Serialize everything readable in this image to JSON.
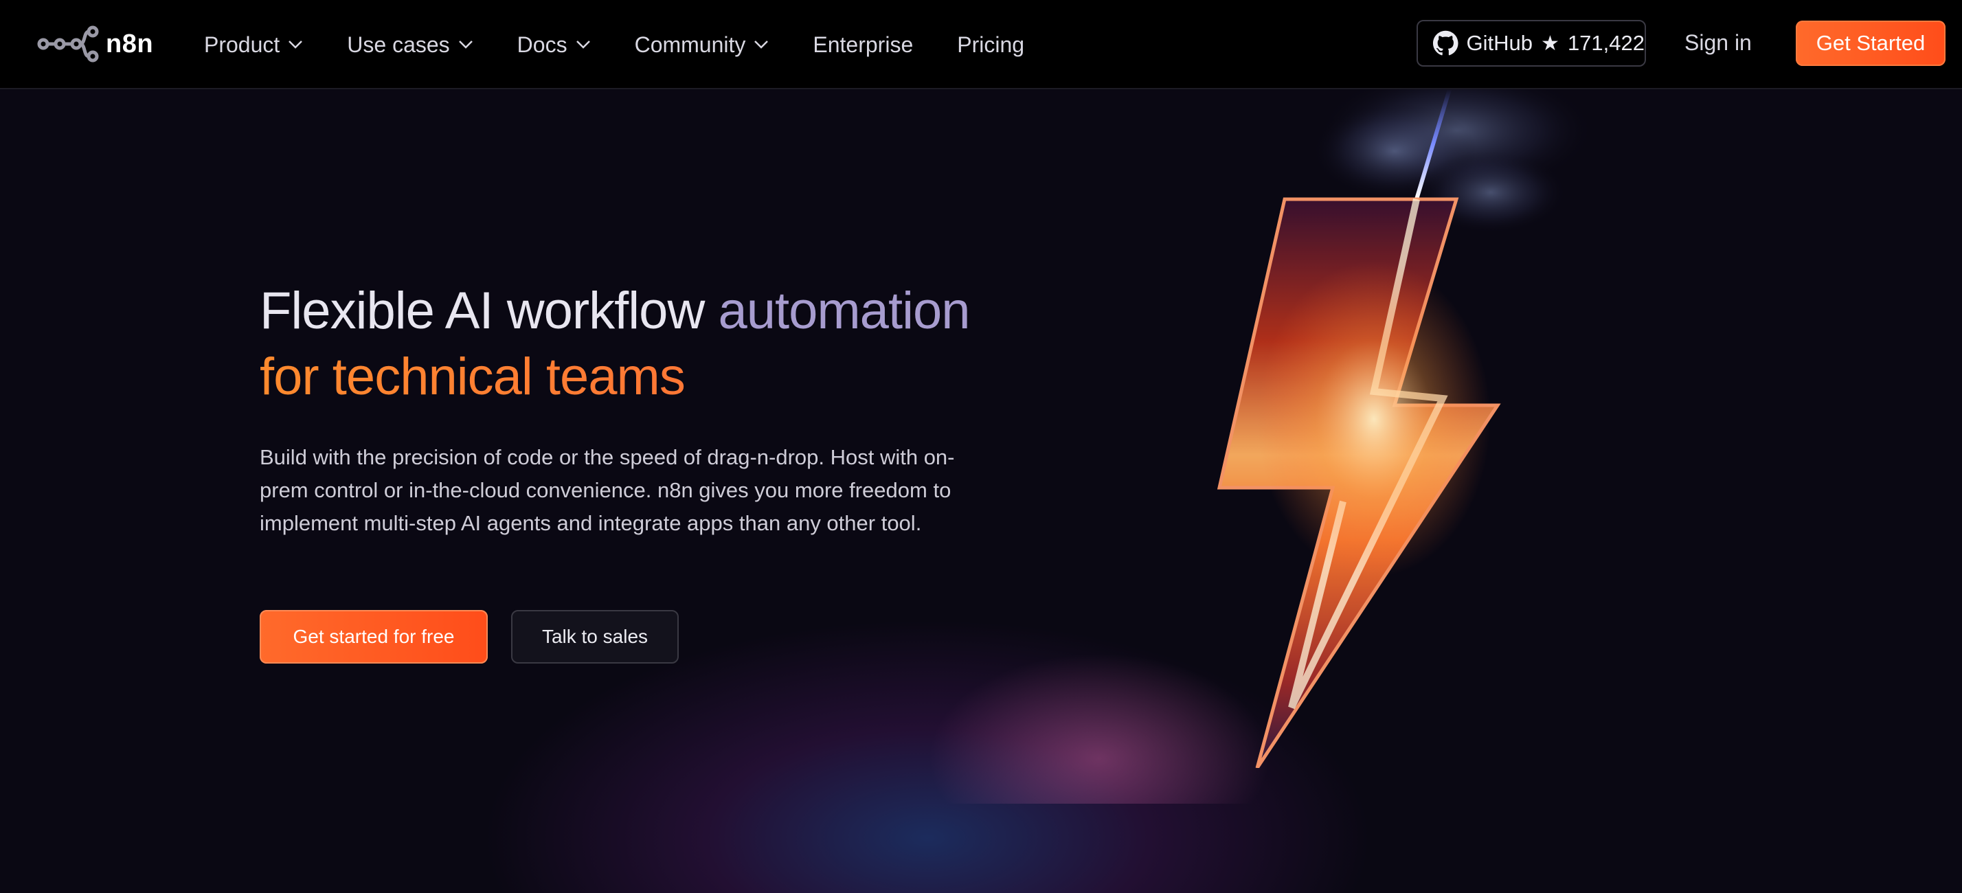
{
  "header": {
    "logo_text": "n8n",
    "nav": [
      {
        "label": "Product",
        "has_dropdown": true
      },
      {
        "label": "Use cases",
        "has_dropdown": true
      },
      {
        "label": "Docs",
        "has_dropdown": true
      },
      {
        "label": "Community",
        "has_dropdown": true
      },
      {
        "label": "Enterprise",
        "has_dropdown": false
      },
      {
        "label": "Pricing",
        "has_dropdown": false
      }
    ],
    "github_label": "GitHub",
    "github_star_glyph": "★",
    "github_stars": "171,422",
    "signin_label": "Sign in",
    "get_started_label": "Get Started"
  },
  "hero": {
    "headline_part1": "Flexible AI workflow ",
    "headline_part2": "automation",
    "headline_part3": "for technical teams",
    "subtext": "Build with the precision of code or the speed of drag-n-drop. Host with on-prem control or in-the-cloud convenience. n8n gives you more freedom to implement multi-step AI agents and integrate apps than any other tool.",
    "cta_primary": "Get started for free",
    "cta_secondary": "Talk to sales"
  },
  "colors": {
    "accent_orange": "#ff6a2b",
    "headline_purple": "#a79ccf",
    "background": "#0a0813"
  },
  "icons": [
    "n8n-logo-icon",
    "chevron-down-icon",
    "github-icon",
    "star-icon",
    "lightning-bolt-illustration"
  ]
}
